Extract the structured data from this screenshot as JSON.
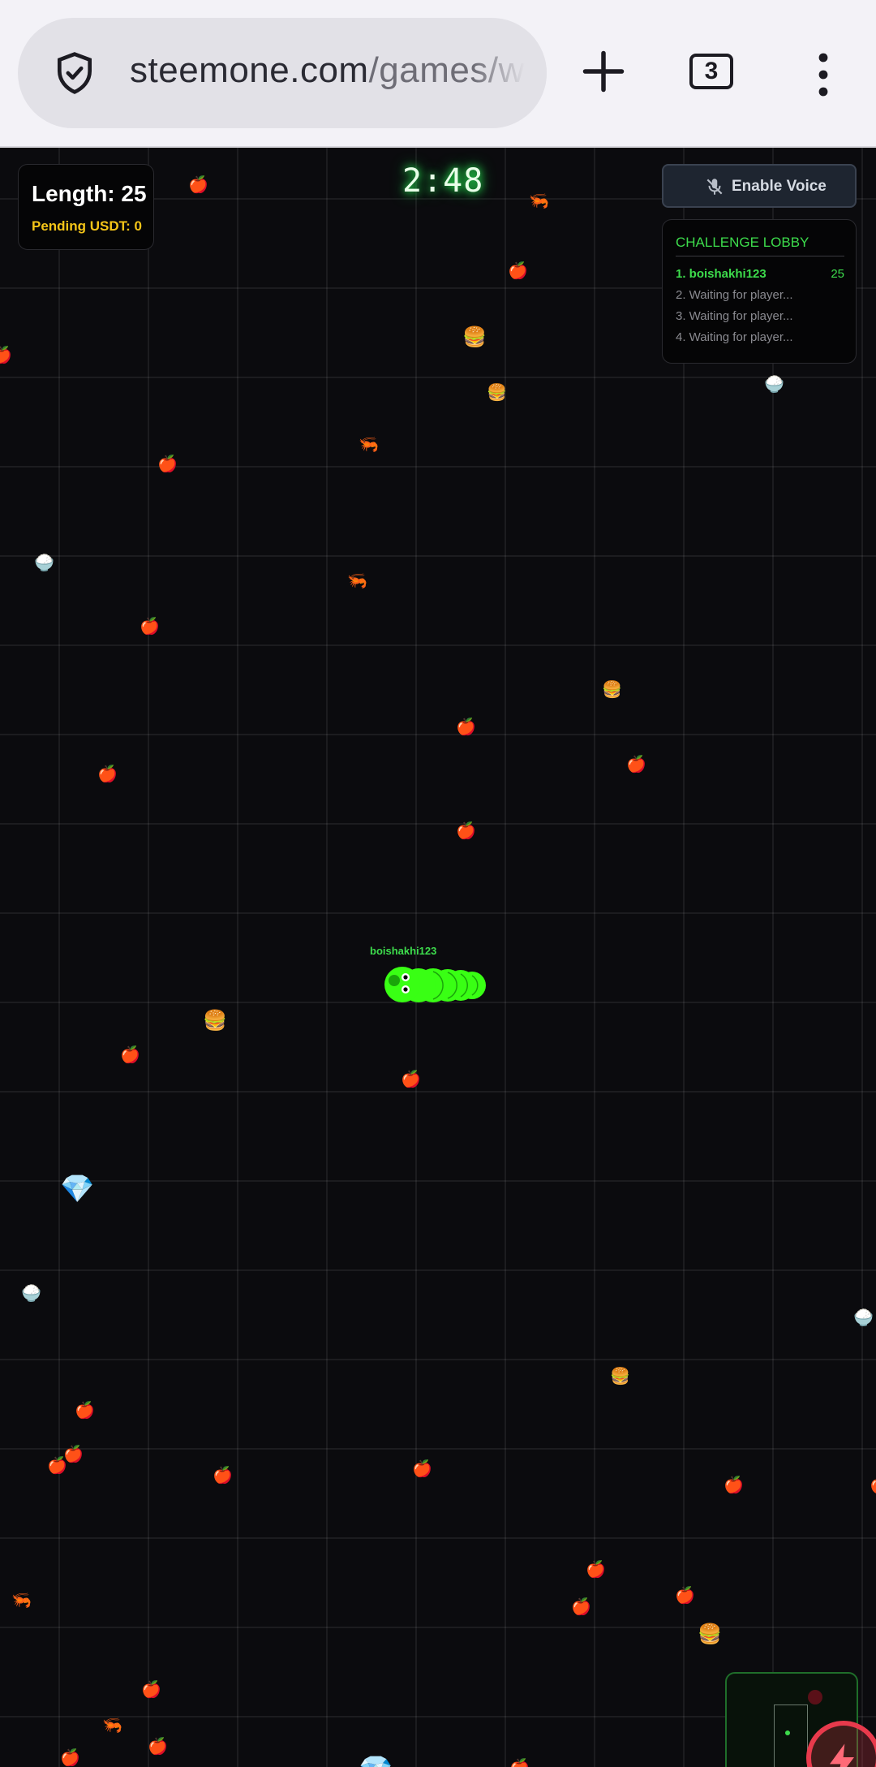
{
  "browser": {
    "url_main": "steemone.com",
    "url_path": "/games/w",
    "tab_count": "3"
  },
  "hud": {
    "length_label": "Length: 25",
    "pending_label": "Pending USDT: 0",
    "timer": "2:48",
    "voice_label": "Enable Voice"
  },
  "lobby": {
    "title": "CHALLENGE LOBBY",
    "rows": [
      {
        "name": "1. boishakhi123",
        "score": "25"
      },
      {
        "name": "2. Waiting for player...",
        "score": ""
      },
      {
        "name": "3. Waiting for player...",
        "score": ""
      },
      {
        "name": "4. Waiting for player...",
        "score": ""
      }
    ]
  },
  "player": {
    "name": "boishakhi123",
    "color": "#39ff14"
  },
  "food_icons": {
    "apple": "🍎",
    "burger": "🍔",
    "shrimp": "🦐",
    "bowl": "🍚",
    "sausage": "🌭",
    "gem": "💎"
  },
  "colors": {
    "accent_green": "#3ddc4c",
    "usdt_yellow": "#f5c518",
    "boost_red": "#e83a4c"
  }
}
